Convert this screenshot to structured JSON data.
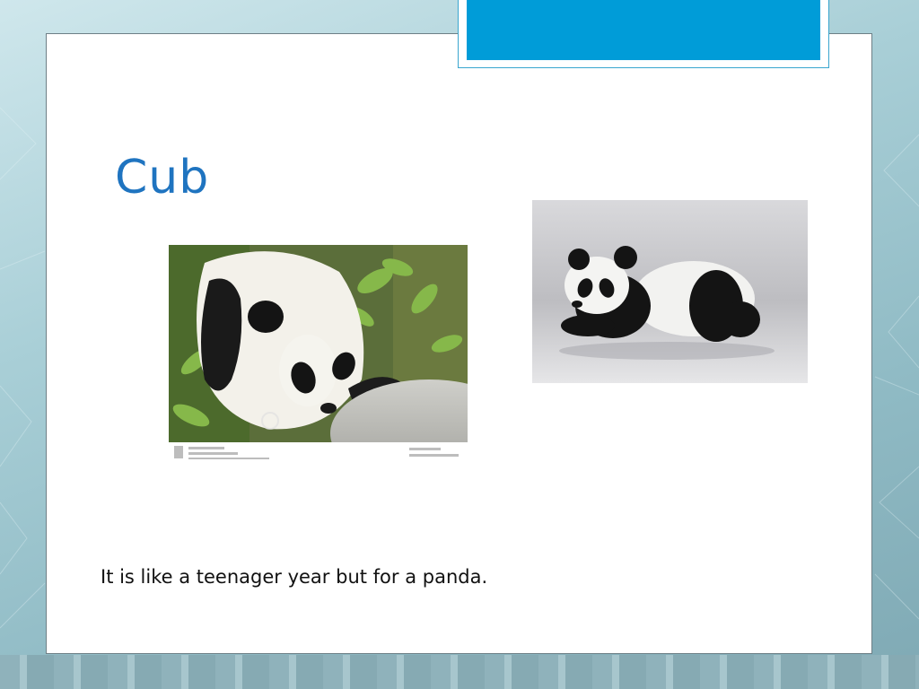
{
  "slide": {
    "title": "Cub",
    "body_text": "It is like a teenager year but for a panda."
  },
  "images": [
    {
      "subject": "panda cub among green plants"
    },
    {
      "subject": "stuffed panda toy lying down"
    }
  ],
  "colors": {
    "accent": "#009cd8",
    "title": "#1f74c0",
    "text": "#111111"
  }
}
